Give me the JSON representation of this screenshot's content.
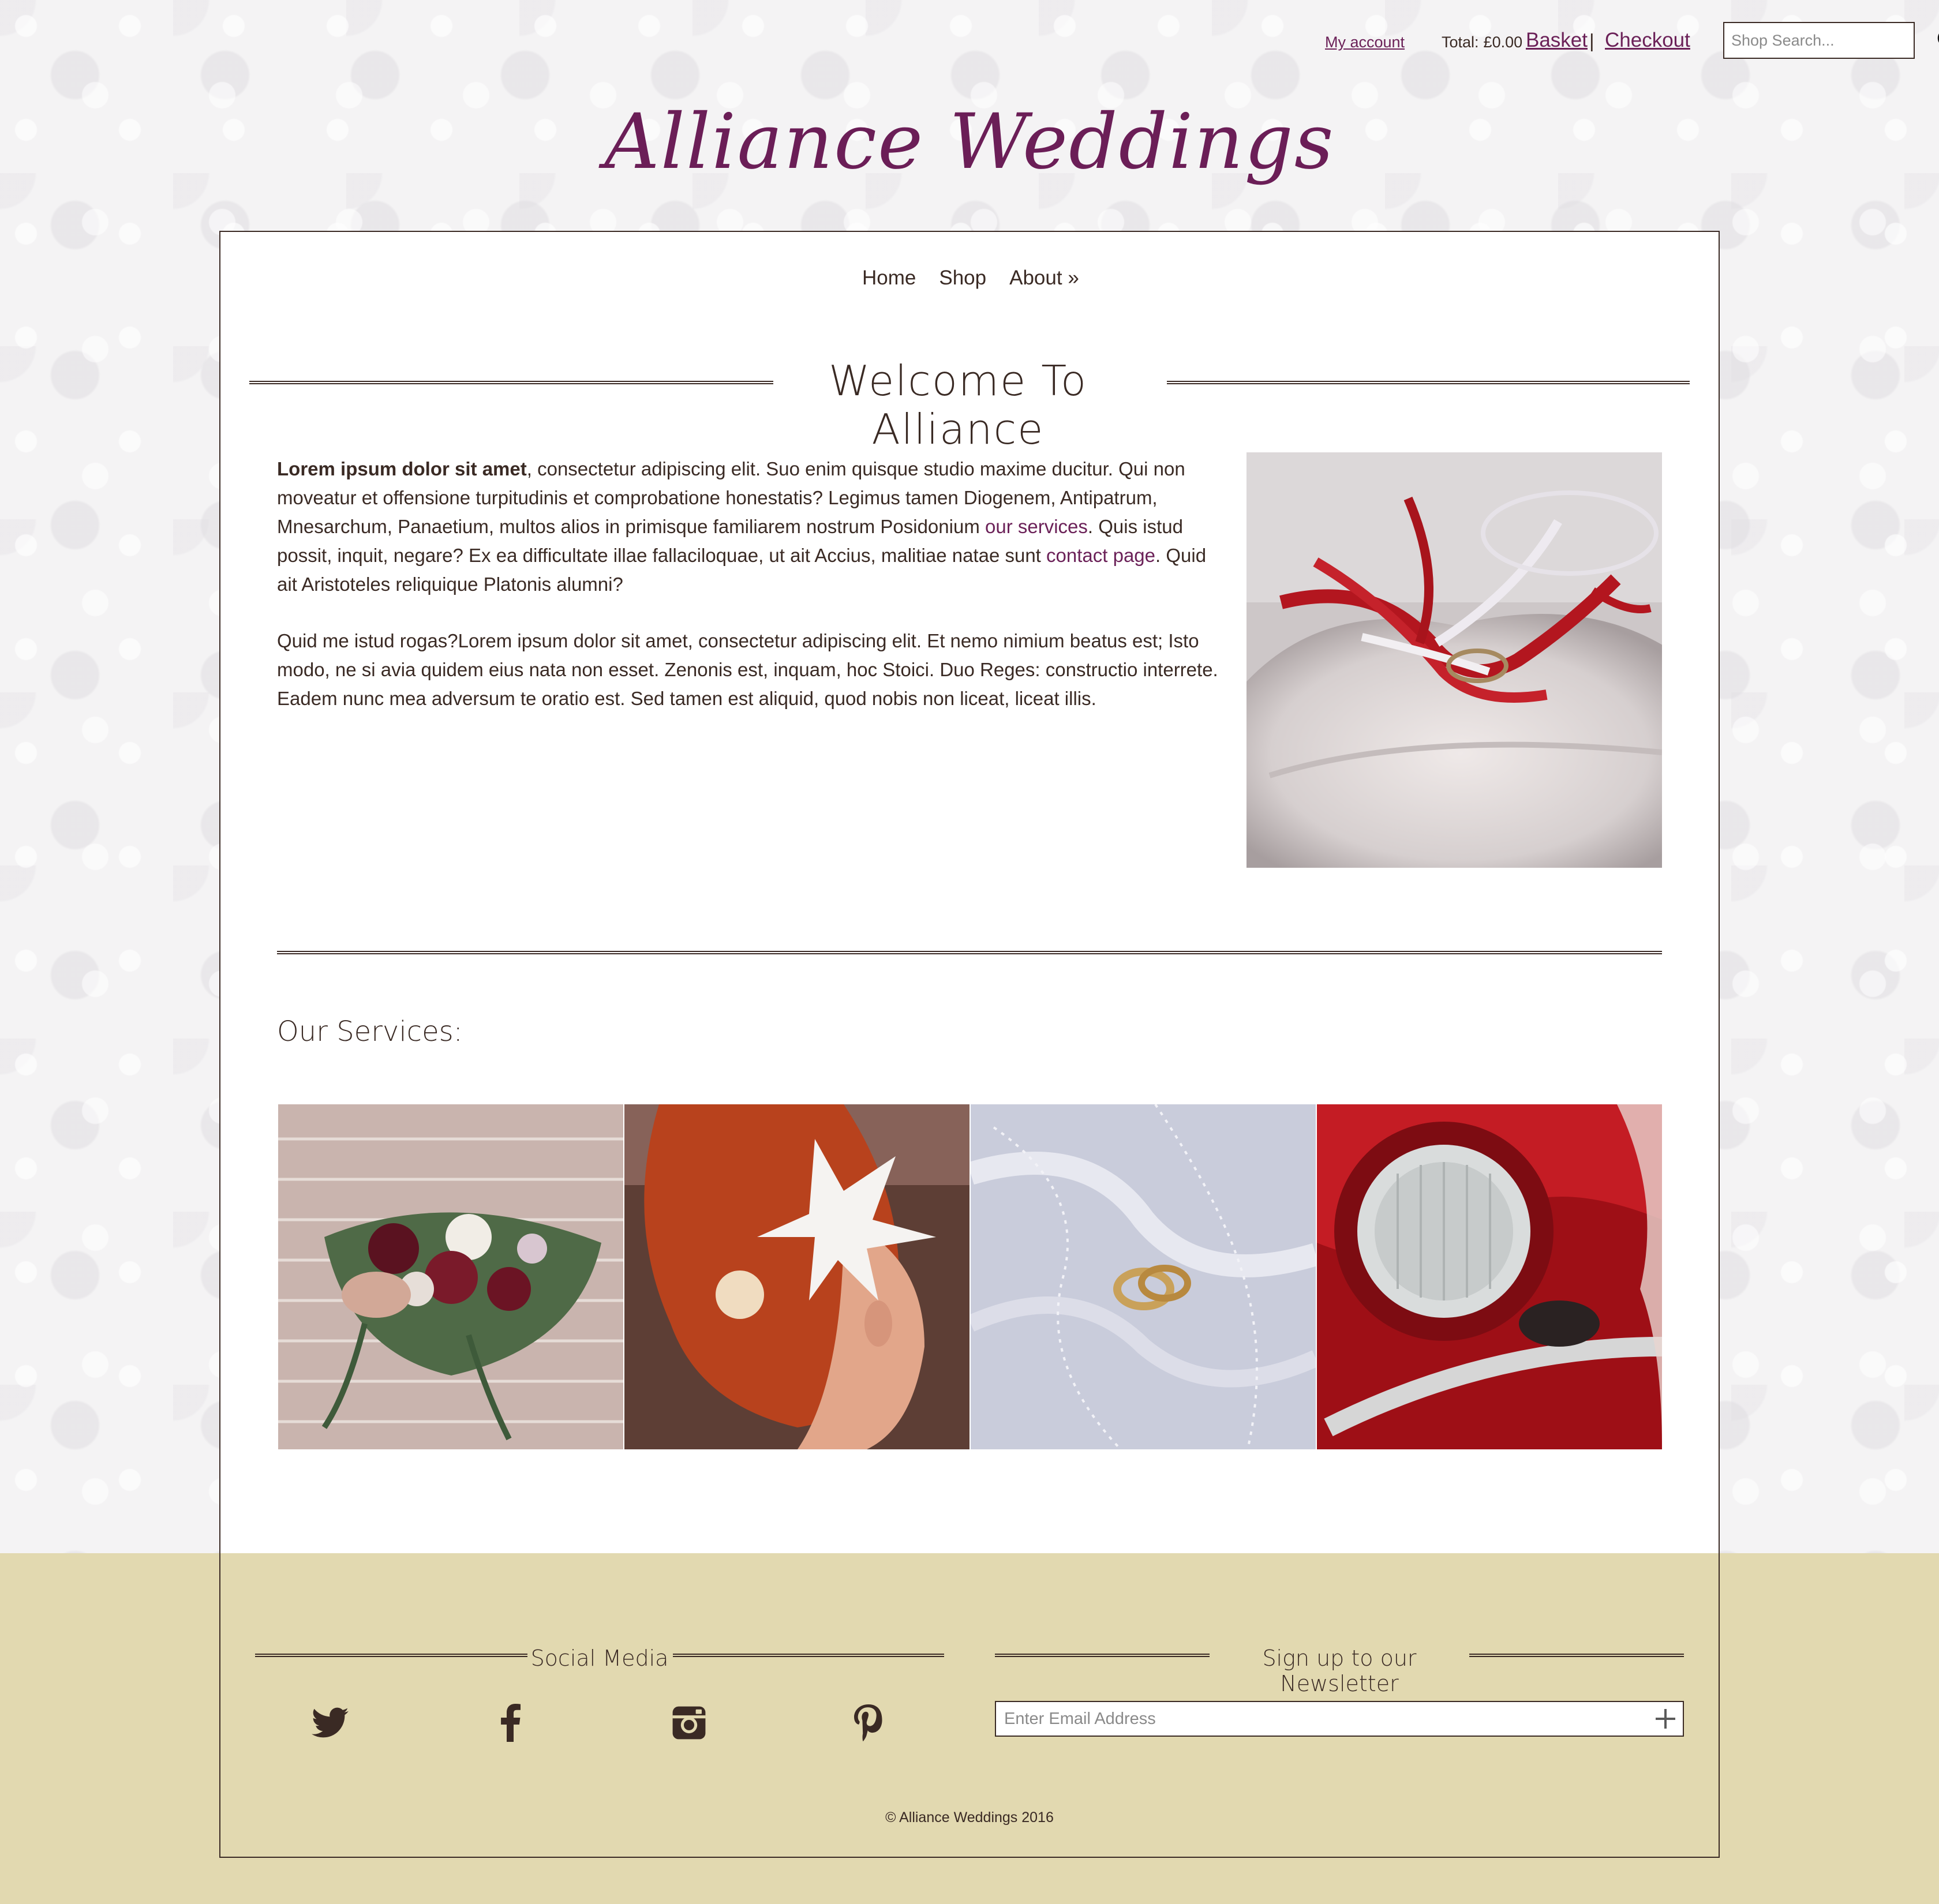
{
  "header": {
    "account_label": "My account",
    "total_label": "Total:",
    "total_amount": "£0.00",
    "basket_label": "Basket",
    "separator": "|",
    "checkout_label": "Checkout",
    "search_placeholder": "Shop Search..."
  },
  "logo": {
    "text": "Alliance Weddings"
  },
  "nav": {
    "items": [
      {
        "label": "Home"
      },
      {
        "label": "Shop"
      },
      {
        "label": "About »"
      }
    ]
  },
  "welcome": {
    "title": "Welcome To Alliance",
    "p1_bold": "Lorem ipsum dolor sit amet",
    "p1_a": ", consectetur adipiscing elit. Suo enim quisque studio maxime ducitur. Qui non moveatur et offensione turpitudinis et comprobatione honestatis? Legimus tamen Diogenem, Antipatrum, Mnesarchum, Panaetium, multos alios in primisque familiarem nostrum Posidonium ",
    "p1_link1": "our services",
    "p1_b": ". Quis istud possit, inquit, negare? Ex ea difficultate illae fallaciloquae, ut ait Accius, malitiae natae sunt ",
    "p1_link2": "contact page",
    "p1_c": ". Quid ait Aristoteles reliquique Platonis alumni?",
    "p2": "Quid me istud rogas?Lorem ipsum dolor sit amet, consectetur adipiscing elit. Et nemo nimium beatus est; Isto modo, ne si avia quidem eius nata non esset. Zenonis est, inquam, hoc Stoici. Duo Reges: constructio interrete. Eadem nunc mea adversum te oratio est. Sed tamen est aliquid, quod nobis non liceat, liceat illis."
  },
  "services": {
    "title": "Our Services:"
  },
  "footer": {
    "social_heading": "Social Media",
    "newsletter_heading": "Sign up to our Newsletter",
    "newsletter_placeholder": "Enter Email Address",
    "copyright": "© Alliance Weddings 2016"
  },
  "colors": {
    "accent": "#6b1e57",
    "text": "#3a2a24",
    "footer_bg": "#e2d9b0"
  }
}
